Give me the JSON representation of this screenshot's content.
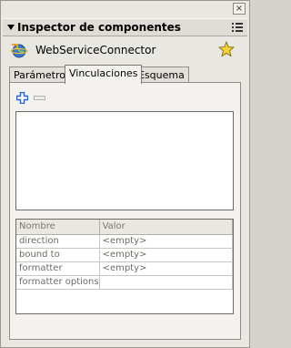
{
  "window": {
    "close_glyph": "×"
  },
  "panel": {
    "title": "Inspector de componentes",
    "collapse_icon": "triangle-down-icon",
    "menu_icon": "panel-options-icon"
  },
  "component": {
    "name": "WebServiceConnector",
    "icon": "web-service-connector-icon",
    "pin_icon": "star-icon"
  },
  "tabs": [
    {
      "label": "Parámetros",
      "active": false
    },
    {
      "label": "Vinculaciones",
      "active": true
    },
    {
      "label": "Esquema",
      "active": false
    }
  ],
  "toolbar": {
    "add_icon": "plus-icon",
    "remove_icon": "minus-icon"
  },
  "properties": {
    "headers": [
      "Nombre",
      "Valor"
    ],
    "rows": [
      {
        "name": "direction",
        "value": "<empty>"
      },
      {
        "name": "bound to",
        "value": "<empty>"
      },
      {
        "name": "formatter",
        "value": "<empty>"
      },
      {
        "name": "formatter options",
        "value": ""
      }
    ]
  },
  "colors": {
    "panel_bg": "#e8e7e1",
    "tab_active_bg": "#f3f2ee",
    "add_icon_blue": "#2b62c8"
  }
}
